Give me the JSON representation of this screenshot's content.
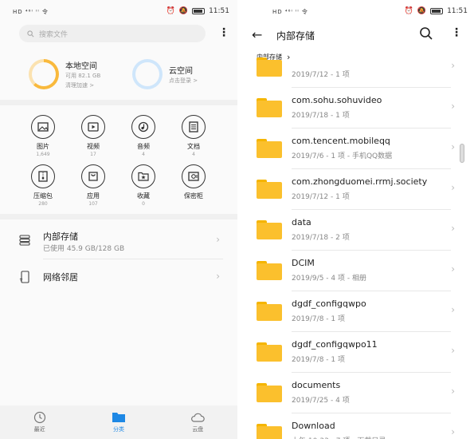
{
  "left": {
    "status": {
      "signal": "HD ⁴⁶ᴵ ᴵᴵ 令",
      "time": "11:51"
    },
    "search": {
      "placeholder": "搜索文件"
    },
    "local_space": {
      "title": "本地空间",
      "available": "可用 82.1 GB",
      "action": "清理加速 >",
      "used_fraction": 0.62
    },
    "cloud_space": {
      "title": "云空间",
      "action": "点击登录 >"
    },
    "categories": [
      {
        "name": "图片",
        "count": "1,649",
        "icon": "image-icon"
      },
      {
        "name": "视频",
        "count": "17",
        "icon": "video-icon"
      },
      {
        "name": "音频",
        "count": "4",
        "icon": "music-icon"
      },
      {
        "name": "文档",
        "count": "4",
        "icon": "document-icon"
      },
      {
        "name": "压缩包",
        "count": "280",
        "icon": "archive-icon"
      },
      {
        "name": "应用",
        "count": "107",
        "icon": "app-package-icon"
      },
      {
        "name": "收藏",
        "count": "0",
        "icon": "favorites-icon"
      },
      {
        "name": "保密柜",
        "count": "",
        "icon": "safe-icon"
      }
    ],
    "internal_storage": {
      "label": "内部存储",
      "usage": "已使用 45.9 GB/128 GB"
    },
    "network": {
      "label": "网络邻居"
    },
    "bottom_nav": [
      {
        "label": "最近",
        "icon": "clock-icon"
      },
      {
        "label": "分类",
        "icon": "folder-icon"
      },
      {
        "label": "云盘",
        "icon": "cloud-icon"
      }
    ],
    "colors": {
      "accent": "#1e88e5",
      "ring": "#f9b93c",
      "cloud_ring": "#cfe6fb"
    }
  },
  "right": {
    "status": {
      "signal": "HD ⁴⁶ᴵ ᴵᴵ 令",
      "time": "11:51"
    },
    "title": "内部存储",
    "breadcrumb": "内部存储",
    "files": [
      {
        "name": "",
        "meta": "2019/7/12 - 1 项"
      },
      {
        "name": "com.sohu.sohuvideo",
        "meta": "2019/7/18 - 1 项"
      },
      {
        "name": "com.tencent.mobileqq",
        "meta": "2019/7/6 - 1 项 - 手机QQ数据"
      },
      {
        "name": "com.zhongduomei.rrmj.society",
        "meta": "2019/7/12 - 1 项"
      },
      {
        "name": "data",
        "meta": "2019/7/18 - 2 项"
      },
      {
        "name": "DCIM",
        "meta": "2019/9/5 - 4 项 - 相册"
      },
      {
        "name": "dgdf_configqwpo",
        "meta": "2019/7/8 - 1 项"
      },
      {
        "name": "dgdf_configqwpo11",
        "meta": "2019/7/8 - 1 项"
      },
      {
        "name": "documents",
        "meta": "2019/7/25 - 4 项"
      },
      {
        "name": "Download",
        "meta": "上午 10:33 - 7 项 - 下载目录"
      }
    ],
    "colors": {
      "folder": "#fbc02d"
    }
  }
}
